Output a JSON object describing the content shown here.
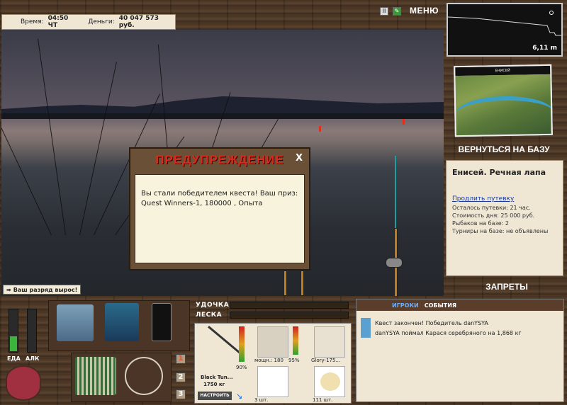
{
  "topbar": {
    "time_label": "Время:",
    "time_value": "04:50 ЧТ",
    "money_label": "Деньги:",
    "money_value": "40 047 573 руб."
  },
  "controls": {
    "pause": "II",
    "edit": "✎",
    "menu_label": "МЕНЮ"
  },
  "depth": {
    "value": "6,11 m"
  },
  "map": {
    "title": "ЕНИСЕЙ"
  },
  "right": {
    "return_button": "ВЕРНУТЬСЯ НА БАЗУ",
    "location": "Енисей. Речная лапа",
    "extend_link": "Продлить путевку",
    "lines": [
      "Осталось путевки: 21 час.",
      "Стоимость дня: 25 000 руб.",
      "Рыбаков на базе: 2",
      "Турниры на базе: не объявлены"
    ],
    "bans_button": "ЗАПРЕТЫ"
  },
  "dialog": {
    "title": "ПРЕДУПРЕЖДЕНИЕ",
    "close": "X",
    "message": "Вы стали победителем квеста! Ваш приз: Quest Winners-1, 180000 , Опыта"
  },
  "rank": {
    "text": "Ваш разряд вырос!"
  },
  "gauges": {
    "food_label": "ЕДА",
    "alc_label": "АЛК",
    "food_level": 0.35,
    "alc_level": 0.0
  },
  "rod_panel": {
    "rod_label": "УДОЧКА",
    "line_label": "ЛЕСКА",
    "rod_name": "Black Tun...",
    "rod_weight": "1750 кг",
    "rod_pct": "90%",
    "setup_button": "НАСТРОИТЬ",
    "reel_power": "мощн.: 180",
    "reel_pct": "95%",
    "bait_name": "Glory-175...",
    "hooks": "3 шт.",
    "bait_count": "111 шт."
  },
  "pages": [
    "1",
    "2",
    "3"
  ],
  "chat": {
    "tab_players": "ИГРОКИ",
    "tab_events": "СОБЫТИЯ",
    "messages": [
      "Квест закончен! Победитель danYSYA",
      "danYSYA поймал Карася серебряного на 1,868 кг"
    ]
  },
  "colors": {
    "accent_red": "#d92a1c",
    "panel": "#efe7d4",
    "wood": "#4a3828"
  }
}
